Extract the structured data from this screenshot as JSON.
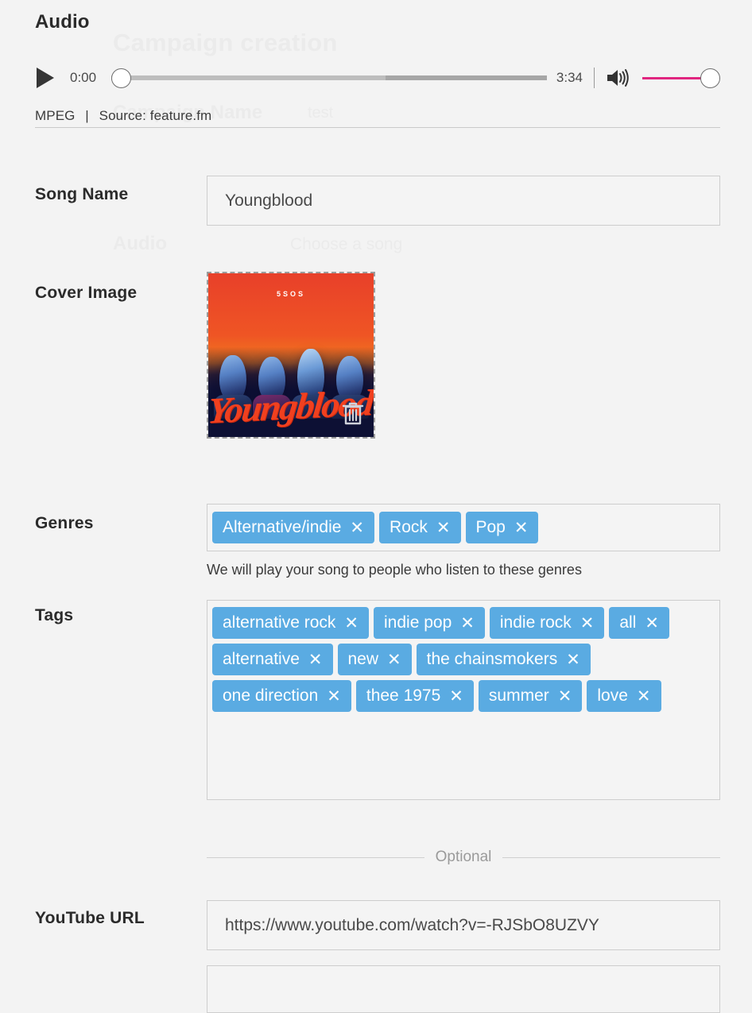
{
  "ghost": {
    "title": "Campaign creation",
    "campaign_name_label": "Campaign Name",
    "campaign_name_value": "test",
    "audio_label": "Audio",
    "choose_song": "Choose a song"
  },
  "section": {
    "heading": "Audio"
  },
  "player": {
    "play_icon": "play-icon",
    "current_time": "0:00",
    "total_time": "3:34",
    "progress_percent": 0,
    "buffered_percent": 63,
    "volume_percent": 100,
    "volume_icon": "speaker-high-icon",
    "volume_color": "#e0257f",
    "track_color": "#bdbdbd",
    "buffer_color": "#a6a6a6"
  },
  "meta": {
    "format": "MPEG",
    "separator": "|",
    "source": "Source: feature.fm"
  },
  "fields": {
    "song_name": {
      "label": "Song Name",
      "value": "Youngblood"
    },
    "cover_image": {
      "label": "Cover Image",
      "artist_text": "5SOS",
      "title_text": "Youngblood",
      "delete_icon": "trash-icon"
    },
    "genres": {
      "label": "Genres",
      "helper": "We will play your song to people who listen to these genres",
      "chips": [
        "Alternative/indie",
        "Rock",
        "Pop"
      ]
    },
    "tags": {
      "label": "Tags",
      "chips": [
        "alternative rock",
        "indie pop",
        "indie rock",
        "all",
        "alternative",
        "new",
        "the chainsmokers",
        "one direction",
        "thee 1975",
        "summer",
        "love"
      ]
    },
    "youtube_url": {
      "label": "YouTube URL",
      "value": "https://www.youtube.com/watch?v=-RJSbO8UZVY"
    }
  },
  "divider": {
    "optional_label": "Optional"
  },
  "chip": {
    "remove_label": "✕",
    "color": "#5aabe2"
  }
}
